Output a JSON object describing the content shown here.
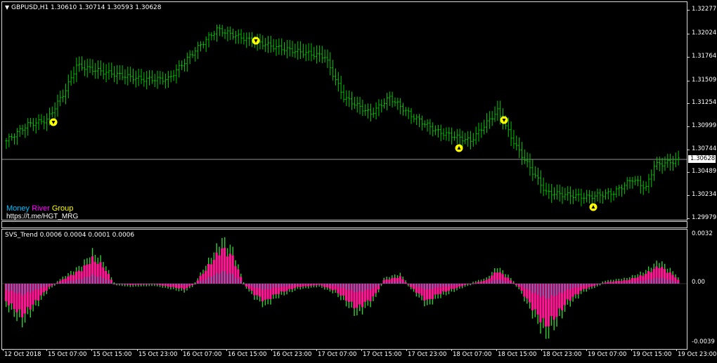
{
  "main_chart": {
    "header": "GBPUSD,H1  1.30610 1.30714 1.30593 1.30628",
    "menu_icon": "triangle-down-icon",
    "price_scale": [
      "1.32277",
      "1.32024",
      "1.31764",
      "1.31509",
      "1.31254",
      "1.30999",
      "1.30744",
      "1.30489",
      "1.30234",
      "1.29979"
    ],
    "current_price": "1.30628",
    "brand": {
      "word1": "Money",
      "word2": "River",
      "word3": "Group",
      "link": "https://t.me/HGT_MRG"
    },
    "colors": {
      "bars": "#00c800",
      "brand1": "#00bfff",
      "brand2": "#ff00ff",
      "brand3": "#ffff00",
      "signal": "#ffff00"
    }
  },
  "sub_chart": {
    "header": "SVS_Trend 0.0006 0.0004 0.0001 0.0006",
    "scale": [
      "0.0032",
      "0.00",
      "-0.0039"
    ],
    "colors": {
      "pink": "#ff1493",
      "green": "#32cd32",
      "blue": "#4682b4"
    }
  },
  "time_axis": [
    "12 Oct 2018",
    "15 Oct 07:00",
    "15 Oct 15:00",
    "15 Oct 23:00",
    "16 Oct 07:00",
    "16 Oct 15:00",
    "16 Oct 23:00",
    "17 Oct 07:00",
    "17 Oct 15:00",
    "17 Oct 23:00",
    "18 Oct 07:00",
    "18 Oct 15:00",
    "18 Oct 23:00",
    "19 Oct 07:00",
    "19 Oct 15:00",
    "19 Oct 23:00"
  ],
  "chart_data": {
    "type": "ohlc",
    "symbol": "GBPUSD",
    "timeframe": "H1",
    "ylim": [
      1.2995,
      1.3235
    ],
    "key_closes": [
      {
        "x": "12 Oct 2018",
        "y": 1.306
      },
      {
        "x": "15 Oct 07:00",
        "y": 1.3115
      },
      {
        "x": "15 Oct 15:00",
        "y": 1.3148
      },
      {
        "x": "15 Oct 23:00",
        "y": 1.315
      },
      {
        "x": "16 Oct 07:00",
        "y": 1.319
      },
      {
        "x": "16 Oct 15:00",
        "y": 1.3195
      },
      {
        "x": "16 Oct 23:00",
        "y": 1.317
      },
      {
        "x": "17 Oct 07:00",
        "y": 1.315
      },
      {
        "x": "17 Oct 15:00",
        "y": 1.3125
      },
      {
        "x": "17 Oct 23:00",
        "y": 1.31
      },
      {
        "x": "18 Oct 07:00",
        "y": 1.311
      },
      {
        "x": "18 Oct 15:00",
        "y": 1.302
      },
      {
        "x": "18 Oct 23:00",
        "y": 1.302
      },
      {
        "x": "19 Oct 07:00",
        "y": 1.3035
      },
      {
        "x": "19 Oct 15:00",
        "y": 1.3065
      },
      {
        "x": "19 Oct 23:00",
        "y": 1.3063
      }
    ],
    "indicator": {
      "name": "SVS_Trend",
      "ylim": [
        -0.0039,
        0.0032
      ]
    }
  }
}
